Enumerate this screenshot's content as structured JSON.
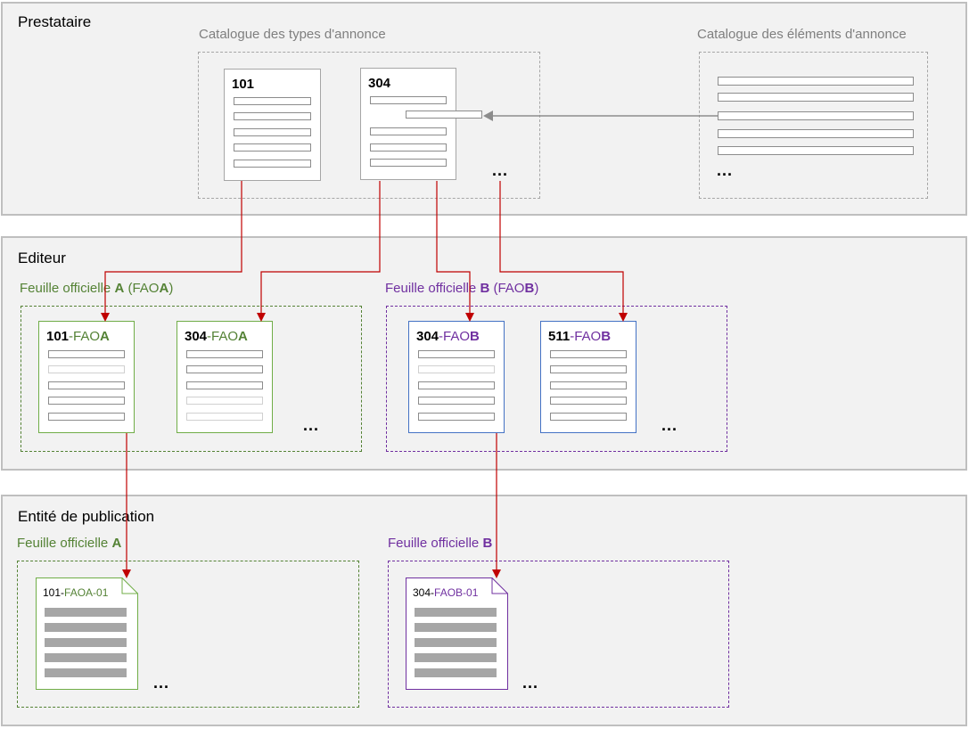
{
  "sections": {
    "prestataire": "Prestataire",
    "editeur": "Editeur",
    "publication": "Entité de publication"
  },
  "catalogs": {
    "types": "Catalogue des types d'annonce",
    "elements": "Catalogue des éléments d'annonce"
  },
  "templates": {
    "t101": "101",
    "t304": "304",
    "ellipsis": "..."
  },
  "editor_sheets": {
    "a": {
      "prefix": "Feuille officielle ",
      "letter": "A",
      "mid": " (FAO",
      "letter2": "A",
      "suffix": ")"
    },
    "b": {
      "prefix": "Feuille officielle ",
      "letter": "B",
      "mid": " (FAO",
      "letter2": "B",
      "suffix": ")"
    }
  },
  "editor_cards": {
    "a101": {
      "num": "101",
      "sep": "-FAO",
      "letter": "A"
    },
    "a304": {
      "num": "304",
      "sep": "-FAO",
      "letter": "A"
    },
    "b304": {
      "num": "304",
      "sep": "-FAO",
      "letter": "B"
    },
    "b511": {
      "num": "511",
      "sep": "-FAO",
      "letter": "B"
    },
    "ellipsis_a": "...",
    "ellipsis_b": "..."
  },
  "publication_sheets": {
    "a": {
      "prefix": "Feuille officielle ",
      "letter": "A"
    },
    "b": {
      "prefix": "Feuille officielle ",
      "letter": "B"
    }
  },
  "publications": {
    "a": {
      "num": "101-",
      "code": "FAOA-01"
    },
    "b": {
      "num": "304-",
      "code": "FAOB-01"
    },
    "ellipsis_a": "...",
    "ellipsis_b": "..."
  },
  "colors": {
    "section_bg": "#f2f2f2",
    "green": "#548235",
    "purple": "#7030a0",
    "blue_border": "#4472c4",
    "arrow_red": "#c00000",
    "arrow_grey": "#8c8c8c"
  }
}
